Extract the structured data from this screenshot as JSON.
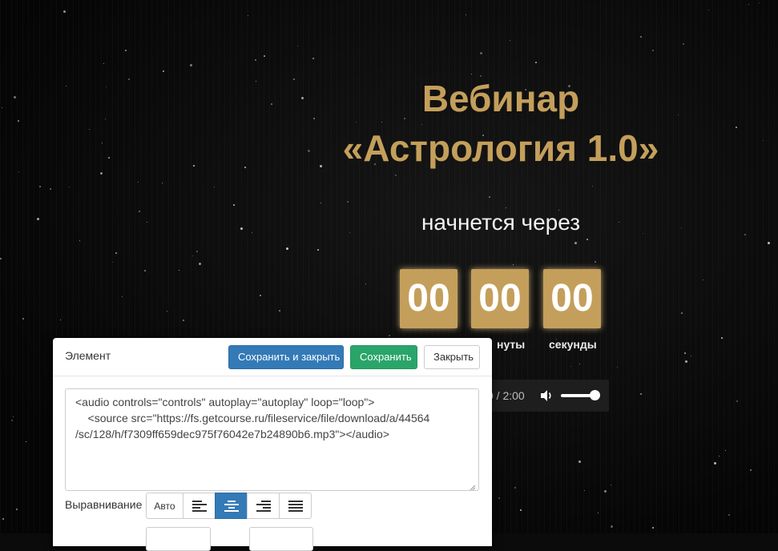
{
  "hero": {
    "title_line1": "Вебинар",
    "title_line2": "«Астрология 1.0»",
    "subtitle": "начнется через"
  },
  "countdown": {
    "minutes": "00",
    "hours_hidden": "00",
    "seconds": "00",
    "minutes_label_partial": "нуты",
    "seconds_label": "секунды"
  },
  "audio": {
    "time": "0 / 2:00",
    "volume_icon": "volume-icon"
  },
  "editor": {
    "title": "Элемент",
    "save_close_label": "Сохранить и закрыть",
    "save_label": "Сохранить",
    "close_label": "Закрыть",
    "code_line1": "<audio controls=\"controls\" autoplay=\"autoplay\" loop=\"loop\">",
    "code_line2": "    <source src=\"https://fs.getcourse.ru/fileservice/file/download/a/44564",
    "code_line3": "/sc/128/h/f7309ff659dec975f76042e7b24890b6.mp3\"></audio>",
    "align_label": "Выравнивание",
    "align_auto": "Авто",
    "active_align": "center"
  },
  "colors": {
    "gold": "#c49f5b",
    "primary": "#337ab7",
    "success": "#2aa56a"
  }
}
